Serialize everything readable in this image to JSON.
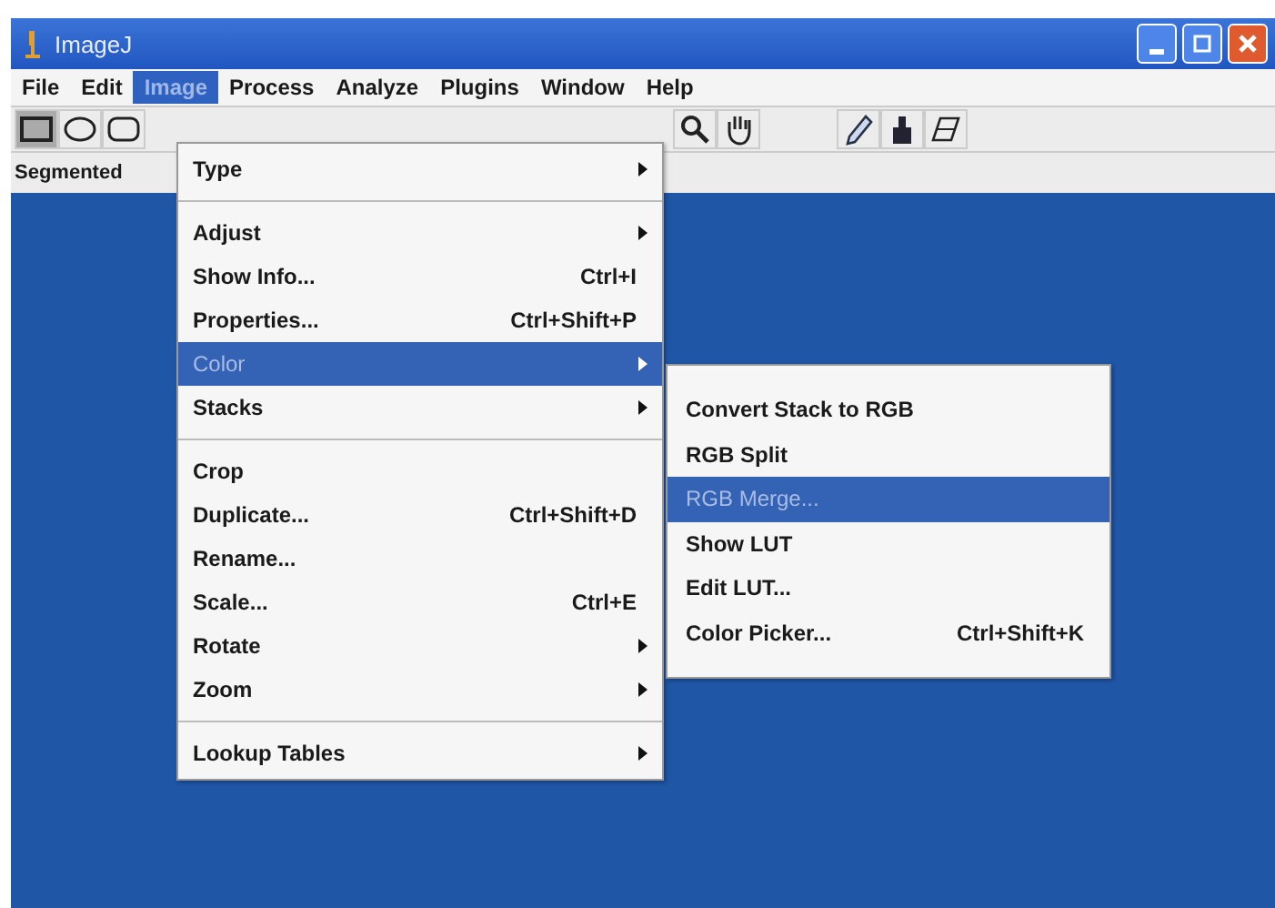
{
  "window": {
    "title": "ImageJ"
  },
  "menubar": [
    {
      "label": "File",
      "selected": false
    },
    {
      "label": "Edit",
      "selected": false
    },
    {
      "label": "Image",
      "selected": true
    },
    {
      "label": "Process",
      "selected": false
    },
    {
      "label": "Analyze",
      "selected": false
    },
    {
      "label": "Plugins",
      "selected": false
    },
    {
      "label": "Window",
      "selected": false
    },
    {
      "label": "Help",
      "selected": false
    }
  ],
  "status_text": "Segmented",
  "image_menu": [
    {
      "kind": "item",
      "label": "Type",
      "submenu": true,
      "selected": false
    },
    {
      "kind": "separator"
    },
    {
      "kind": "item",
      "label": "Adjust",
      "submenu": true,
      "selected": false
    },
    {
      "kind": "item",
      "label": "Show Info...",
      "shortcut": "Ctrl+I",
      "selected": false
    },
    {
      "kind": "item",
      "label": "Properties...",
      "shortcut": "Ctrl+Shift+P",
      "selected": false
    },
    {
      "kind": "item",
      "label": "Color",
      "submenu": true,
      "selected": true
    },
    {
      "kind": "item",
      "label": "Stacks",
      "submenu": true,
      "selected": false
    },
    {
      "kind": "separator"
    },
    {
      "kind": "item",
      "label": "Crop",
      "selected": false
    },
    {
      "kind": "item",
      "label": "Duplicate...",
      "shortcut": "Ctrl+Shift+D",
      "selected": false
    },
    {
      "kind": "item",
      "label": "Rename...",
      "selected": false
    },
    {
      "kind": "item",
      "label": "Scale...",
      "shortcut": "Ctrl+E",
      "selected": false
    },
    {
      "kind": "item",
      "label": "Rotate",
      "submenu": true,
      "selected": false
    },
    {
      "kind": "item",
      "label": "Zoom",
      "submenu": true,
      "selected": false
    },
    {
      "kind": "separator"
    },
    {
      "kind": "item",
      "label": "Lookup Tables",
      "submenu": true,
      "selected": false
    }
  ],
  "color_submenu": [
    {
      "label": "Convert Stack to RGB",
      "selected": false
    },
    {
      "label": "RGB Split",
      "selected": false
    },
    {
      "label": "RGB Merge...",
      "selected": true
    },
    {
      "label": "Show LUT",
      "selected": false
    },
    {
      "label": "Edit LUT...",
      "selected": false
    },
    {
      "label": "Color Picker...",
      "shortcut": "Ctrl+Shift+K",
      "selected": false
    }
  ]
}
